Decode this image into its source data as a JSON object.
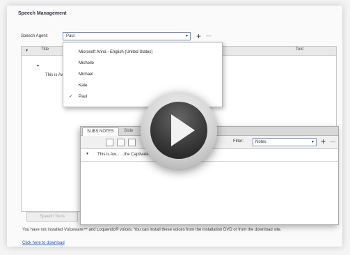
{
  "window": {
    "title": "Speech Management"
  },
  "speech_agent": {
    "label": "Speech Agent:",
    "selected": "Paul",
    "options": [
      {
        "label": "Microsoft Anna - English (United States)",
        "checked": false
      },
      {
        "label": "Michelle",
        "checked": false
      },
      {
        "label": "Michael",
        "checked": false
      },
      {
        "label": "Kate",
        "checked": false
      },
      {
        "label": "Paul",
        "checked": true
      }
    ]
  },
  "grid": {
    "columns": [
      "Title",
      "Text"
    ],
    "row_text": "This is Aw"
  },
  "sub_panel": {
    "tabs": [
      "SUBS NOTES",
      "Slide"
    ],
    "filter_label": "Filter:",
    "filter_value": "Notes",
    "row_text": "This is Aw... ...the Captivate."
  },
  "buttons": {
    "disabled_label": "Speech Tools"
  },
  "footer": {
    "message": "You have not installed Voiceware™ and Loquendo® voices. You can install these voices from the installation DVD or from the download site.",
    "link": "Click here to download"
  },
  "colors": {
    "accent": "#2c5bbf",
    "check": "#2b4fa0"
  },
  "icons": {
    "add": "plus-icon",
    "remove": "minus-icon",
    "play": "play-icon"
  }
}
